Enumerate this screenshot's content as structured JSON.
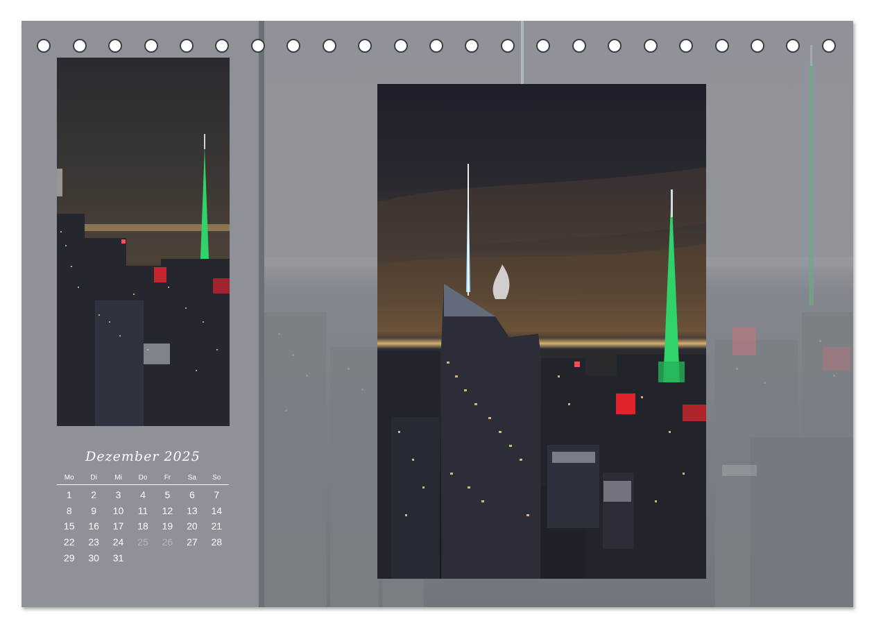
{
  "calendar": {
    "title": "Dezember 2025",
    "weekdays": [
      "Mo",
      "Di",
      "Mi",
      "Do",
      "Fr",
      "Sa",
      "So"
    ],
    "days": [
      "1",
      "2",
      "3",
      "4",
      "5",
      "6",
      "7",
      "8",
      "9",
      "10",
      "11",
      "12",
      "13",
      "14",
      "15",
      "16",
      "17",
      "18",
      "19",
      "20",
      "21",
      "22",
      "23",
      "24",
      "25",
      "26",
      "27",
      "28",
      "29",
      "30",
      "31"
    ],
    "holidays": [
      "25",
      "26"
    ]
  },
  "photos": {
    "main": "new-york-skyline-night",
    "side": "new-york-skyline-night-detail",
    "background": "new-york-skyline-faded"
  },
  "ring_holes": 23,
  "colors": {
    "panel": "#8e9298",
    "divider": "#6b7077",
    "text": "#ffffff",
    "holiday_text": "#b4b7bb",
    "spire_green": "#2fd36a",
    "spire_blue": "#9fd8ff",
    "sign_red": "#e0242c"
  }
}
